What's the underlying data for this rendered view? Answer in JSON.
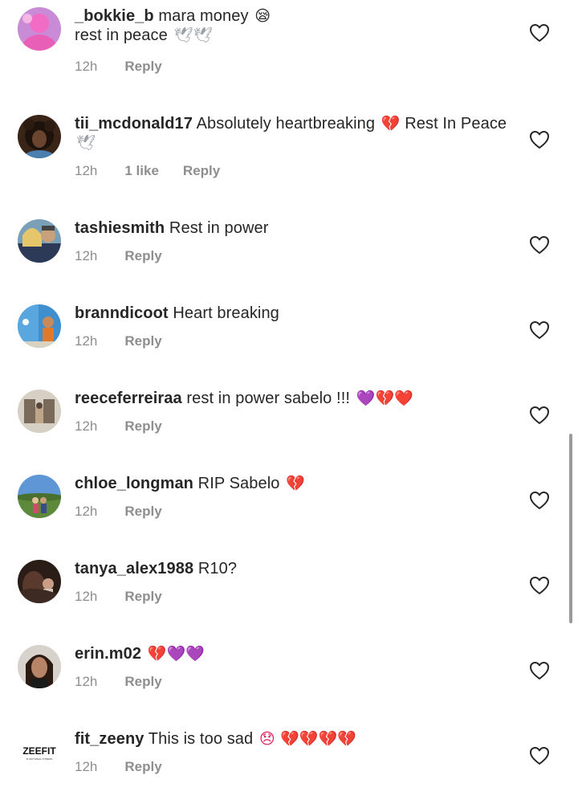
{
  "comments": [
    {
      "username": "_bokkie_b",
      "text": "mara money",
      "emoji": "😪",
      "text2": "rest in peace",
      "emoji2": "🕊🕊",
      "time": "12h",
      "likes": "",
      "reply": "Reply"
    },
    {
      "username": "tii_mcdonald17",
      "text": "Absolutely heartbreaking",
      "emoji": "💔",
      "text2": "Rest In Peace",
      "emoji2": "🕊",
      "time": "12h",
      "likes": "1 like",
      "reply": "Reply"
    },
    {
      "username": "tashiesmith",
      "text": "Rest in power",
      "emoji": "",
      "time": "12h",
      "likes": "",
      "reply": "Reply"
    },
    {
      "username": "branndicoot",
      "text": "Heart breaking",
      "emoji": "",
      "time": "12h",
      "likes": "",
      "reply": "Reply"
    },
    {
      "username": "reeceferreiraa",
      "text": "rest in power sabelo !!!",
      "emoji": "💜💔❤️",
      "time": "12h",
      "likes": "",
      "reply": "Reply"
    },
    {
      "username": "chloe_longman",
      "text": "RIP Sabelo",
      "emoji": "💔",
      "time": "12h",
      "likes": "",
      "reply": "Reply"
    },
    {
      "username": "tanya_alex1988",
      "text": "R10?",
      "emoji": "",
      "time": "12h",
      "likes": "",
      "reply": "Reply"
    },
    {
      "username": "erin.m02",
      "text": "",
      "emoji": "💔💜💜",
      "time": "12h",
      "likes": "",
      "reply": "Reply"
    },
    {
      "username": "fit_zeeny",
      "text": "This is too sad",
      "emoji": "😞 💔💔💔💔",
      "time": "12h",
      "likes": "",
      "reply": "Reply"
    }
  ],
  "avatars": {
    "fit_zeeny_logo": "ZEEFIT",
    "fit_zeeny_tagline": "FUNCTIONAL FITNESS"
  },
  "colors": {
    "text": "#262626",
    "meta": "#8e8e8e",
    "heart_outline": "#262626",
    "broken_heart": "#e0245e",
    "purple_heart": "#a33ee0"
  }
}
